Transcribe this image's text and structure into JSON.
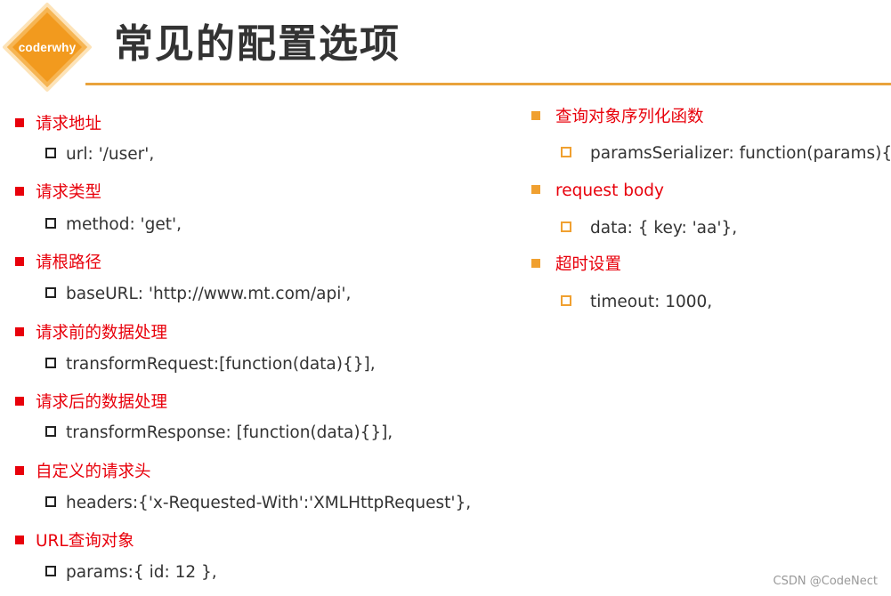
{
  "logo": {
    "text": "coderwhy"
  },
  "title": "常见的配置选项",
  "left_items": [
    {
      "label": "请求地址",
      "value": "url: '/user',"
    },
    {
      "label": "请求类型",
      "value": "method: 'get',"
    },
    {
      "label": "请根路径",
      "value": "baseURL: 'http://www.mt.com/api',"
    },
    {
      "label": "请求前的数据处理",
      "value": "transformRequest:[function(data){}],"
    },
    {
      "label": "请求后的数据处理",
      "value": "transformResponse: [function(data){}],"
    },
    {
      "label": "自定义的请求头",
      "value": "headers:{'x-Requested-With':'XMLHttpRequest'},"
    },
    {
      "label": "URL查询对象",
      "value": "params:{ id: 12 },"
    }
  ],
  "right_items": [
    {
      "label": "查询对象序列化函数",
      "value": "paramsSerializer: function(params){ }"
    },
    {
      "label": "request body",
      "value": "data: { key: 'aa'},"
    },
    {
      "label": "超时设置",
      "value": "timeout: 1000,"
    }
  ],
  "watermark": "CSDN @CodeNect",
  "colors": {
    "accent": "#e9a33c",
    "label_red": "#e8000b",
    "bullet_orange": "#f0a030"
  }
}
